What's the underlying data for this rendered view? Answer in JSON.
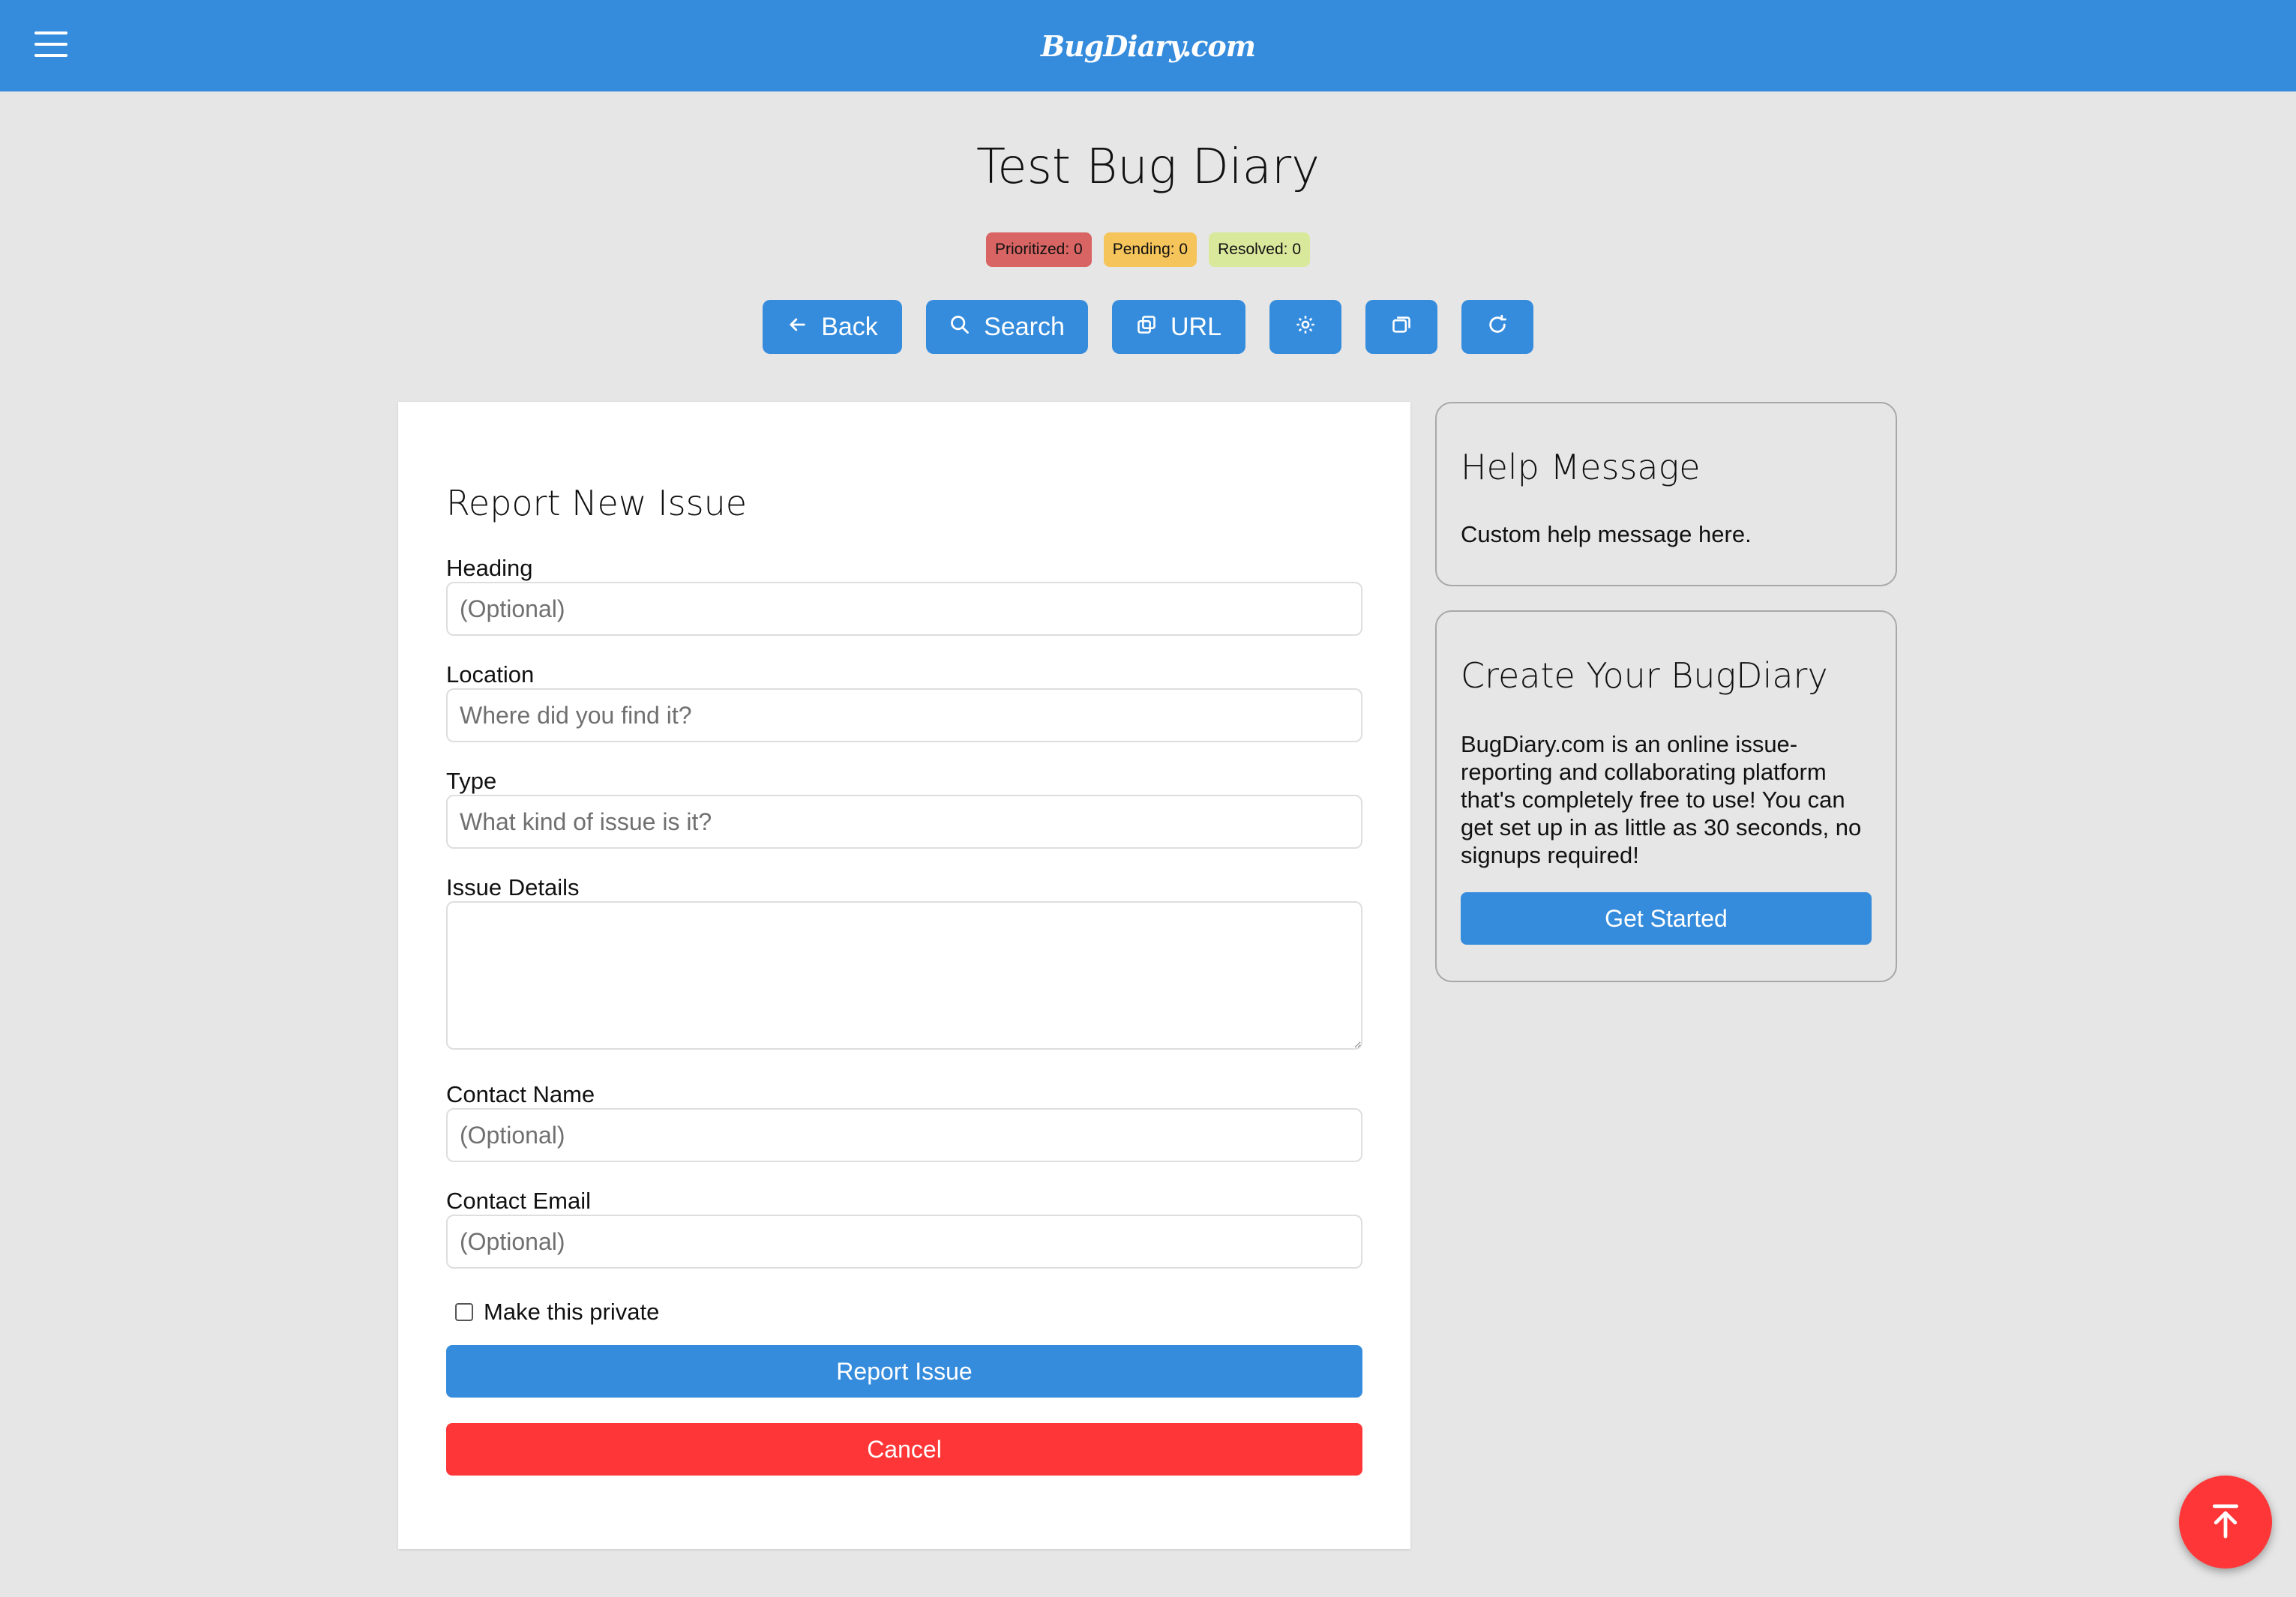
{
  "header": {
    "brand": "BugDiary.com",
    "menu_icon": "hamburger-menu-icon"
  },
  "page": {
    "title": "Test Bug Diary"
  },
  "status_badges": {
    "prioritized": "Prioritized: 0",
    "pending": "Pending: 0",
    "resolved": "Resolved: 0",
    "colors": {
      "prioritized": "#d86464",
      "pending": "#f5c45a",
      "resolved": "#d9e99c"
    }
  },
  "toolbar": {
    "back_label": "Back",
    "search_label": "Search",
    "url_label": "URL",
    "icons": [
      "arrow-left-icon",
      "search-icon",
      "copy-icon",
      "gear-icon",
      "window-icon",
      "refresh-icon"
    ]
  },
  "form": {
    "heading": "Report New Issue",
    "fields": {
      "heading": {
        "label": "Heading",
        "placeholder": "(Optional)",
        "value": ""
      },
      "location": {
        "label": "Location",
        "placeholder": "Where did you find it?",
        "value": ""
      },
      "type": {
        "label": "Type",
        "placeholder": "What kind of issue is it?",
        "value": ""
      },
      "details": {
        "label": "Issue Details",
        "value": ""
      },
      "contact_name": {
        "label": "Contact Name",
        "placeholder": "(Optional)",
        "value": ""
      },
      "contact_email": {
        "label": "Contact Email",
        "placeholder": "(Optional)",
        "value": ""
      }
    },
    "private_label": "Make this private",
    "private_checked": false,
    "submit_label": "Report Issue",
    "cancel_label": "Cancel"
  },
  "help": {
    "title": "Help Message",
    "text": "Custom help message here."
  },
  "promo": {
    "title": "Create Your BugDiary",
    "text": "BugDiary.com is an online issue-reporting and collaborating platform that's completely free to use! You can get set up in as little as 30 seconds, no signups required!",
    "button_label": "Get Started"
  },
  "fab": {
    "icon": "scroll-to-top-icon"
  },
  "colors": {
    "primary": "#368cdc",
    "danger": "#fe3637",
    "background": "#e6e6e6"
  }
}
